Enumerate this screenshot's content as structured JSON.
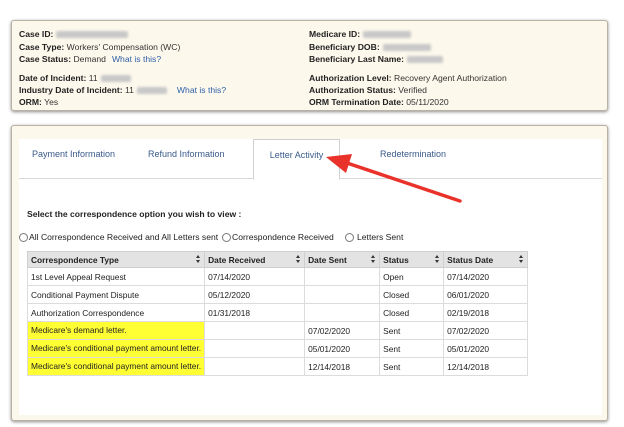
{
  "case": {
    "case_id_label": "Case ID:",
    "case_type_label": "Case Type:",
    "case_type_value": "Workers' Compensation (WC)",
    "case_status_label": "Case Status:",
    "case_status_value": "Demand",
    "what_is_this": "What is this?",
    "date_of_incident_label": "Date of Incident:",
    "date_of_incident_value": "11",
    "industry_date_label": "Industry Date of Incident:",
    "industry_date_value": "11",
    "orm_label": "ORM:",
    "orm_value": "Yes",
    "medicare_id_label": "Medicare ID:",
    "beneficiary_dob_label": "Beneficiary DOB:",
    "beneficiary_last_name_label": "Beneficiary Last Name:",
    "auth_level_label": "Authorization Level:",
    "auth_level_value": "Recovery Agent Authorization",
    "auth_status_label": "Authorization Status:",
    "auth_status_value": "Verified",
    "orm_termination_label": "ORM Termination Date:",
    "orm_termination_value": "05/11/2020"
  },
  "tabs": [
    {
      "label": "Payment Information"
    },
    {
      "label": "Refund Information"
    },
    {
      "label": "Letter Activity"
    },
    {
      "label": "Redetermination"
    }
  ],
  "prompt": "Select the correspondence option you wish to view :",
  "radios": [
    {
      "label": "All Correspondence Received and All Letters sent"
    },
    {
      "label": "Correspondence Received"
    },
    {
      "label": "Letters Sent"
    }
  ],
  "table": {
    "headers": [
      "Correspondence Type",
      "Date Received",
      "Date Sent",
      "Status",
      "Status Date"
    ],
    "rows": [
      {
        "type": "1st Level Appeal Request",
        "received": "07/14/2020",
        "sent": "",
        "status": "Open",
        "status_date": "07/14/2020"
      },
      {
        "type": "Conditional Payment Dispute",
        "received": "05/12/2020",
        "sent": "",
        "status": "Closed",
        "status_date": "06/01/2020"
      },
      {
        "type": "Authorization Correspondence",
        "received": "01/31/2018",
        "sent": "",
        "status": "Closed",
        "status_date": "02/19/2018"
      },
      {
        "type": "Medicare's demand letter.",
        "received": "",
        "sent": "07/02/2020",
        "status": "Sent",
        "status_date": "07/02/2020"
      },
      {
        "type": "Medicare's conditional payment amount letter.",
        "received": "",
        "sent": "05/01/2020",
        "status": "Sent",
        "status_date": "05/01/2020"
      },
      {
        "type": "Medicare's conditional payment amount letter.",
        "received": "",
        "sent": "12/14/2018",
        "status": "Sent",
        "status_date": "12/14/2018"
      }
    ]
  },
  "colors": {
    "highlight": "#ffff33",
    "arrow": "#e8322a",
    "link": "#2b5fa8",
    "panel_bg": "#fdf8ec"
  }
}
